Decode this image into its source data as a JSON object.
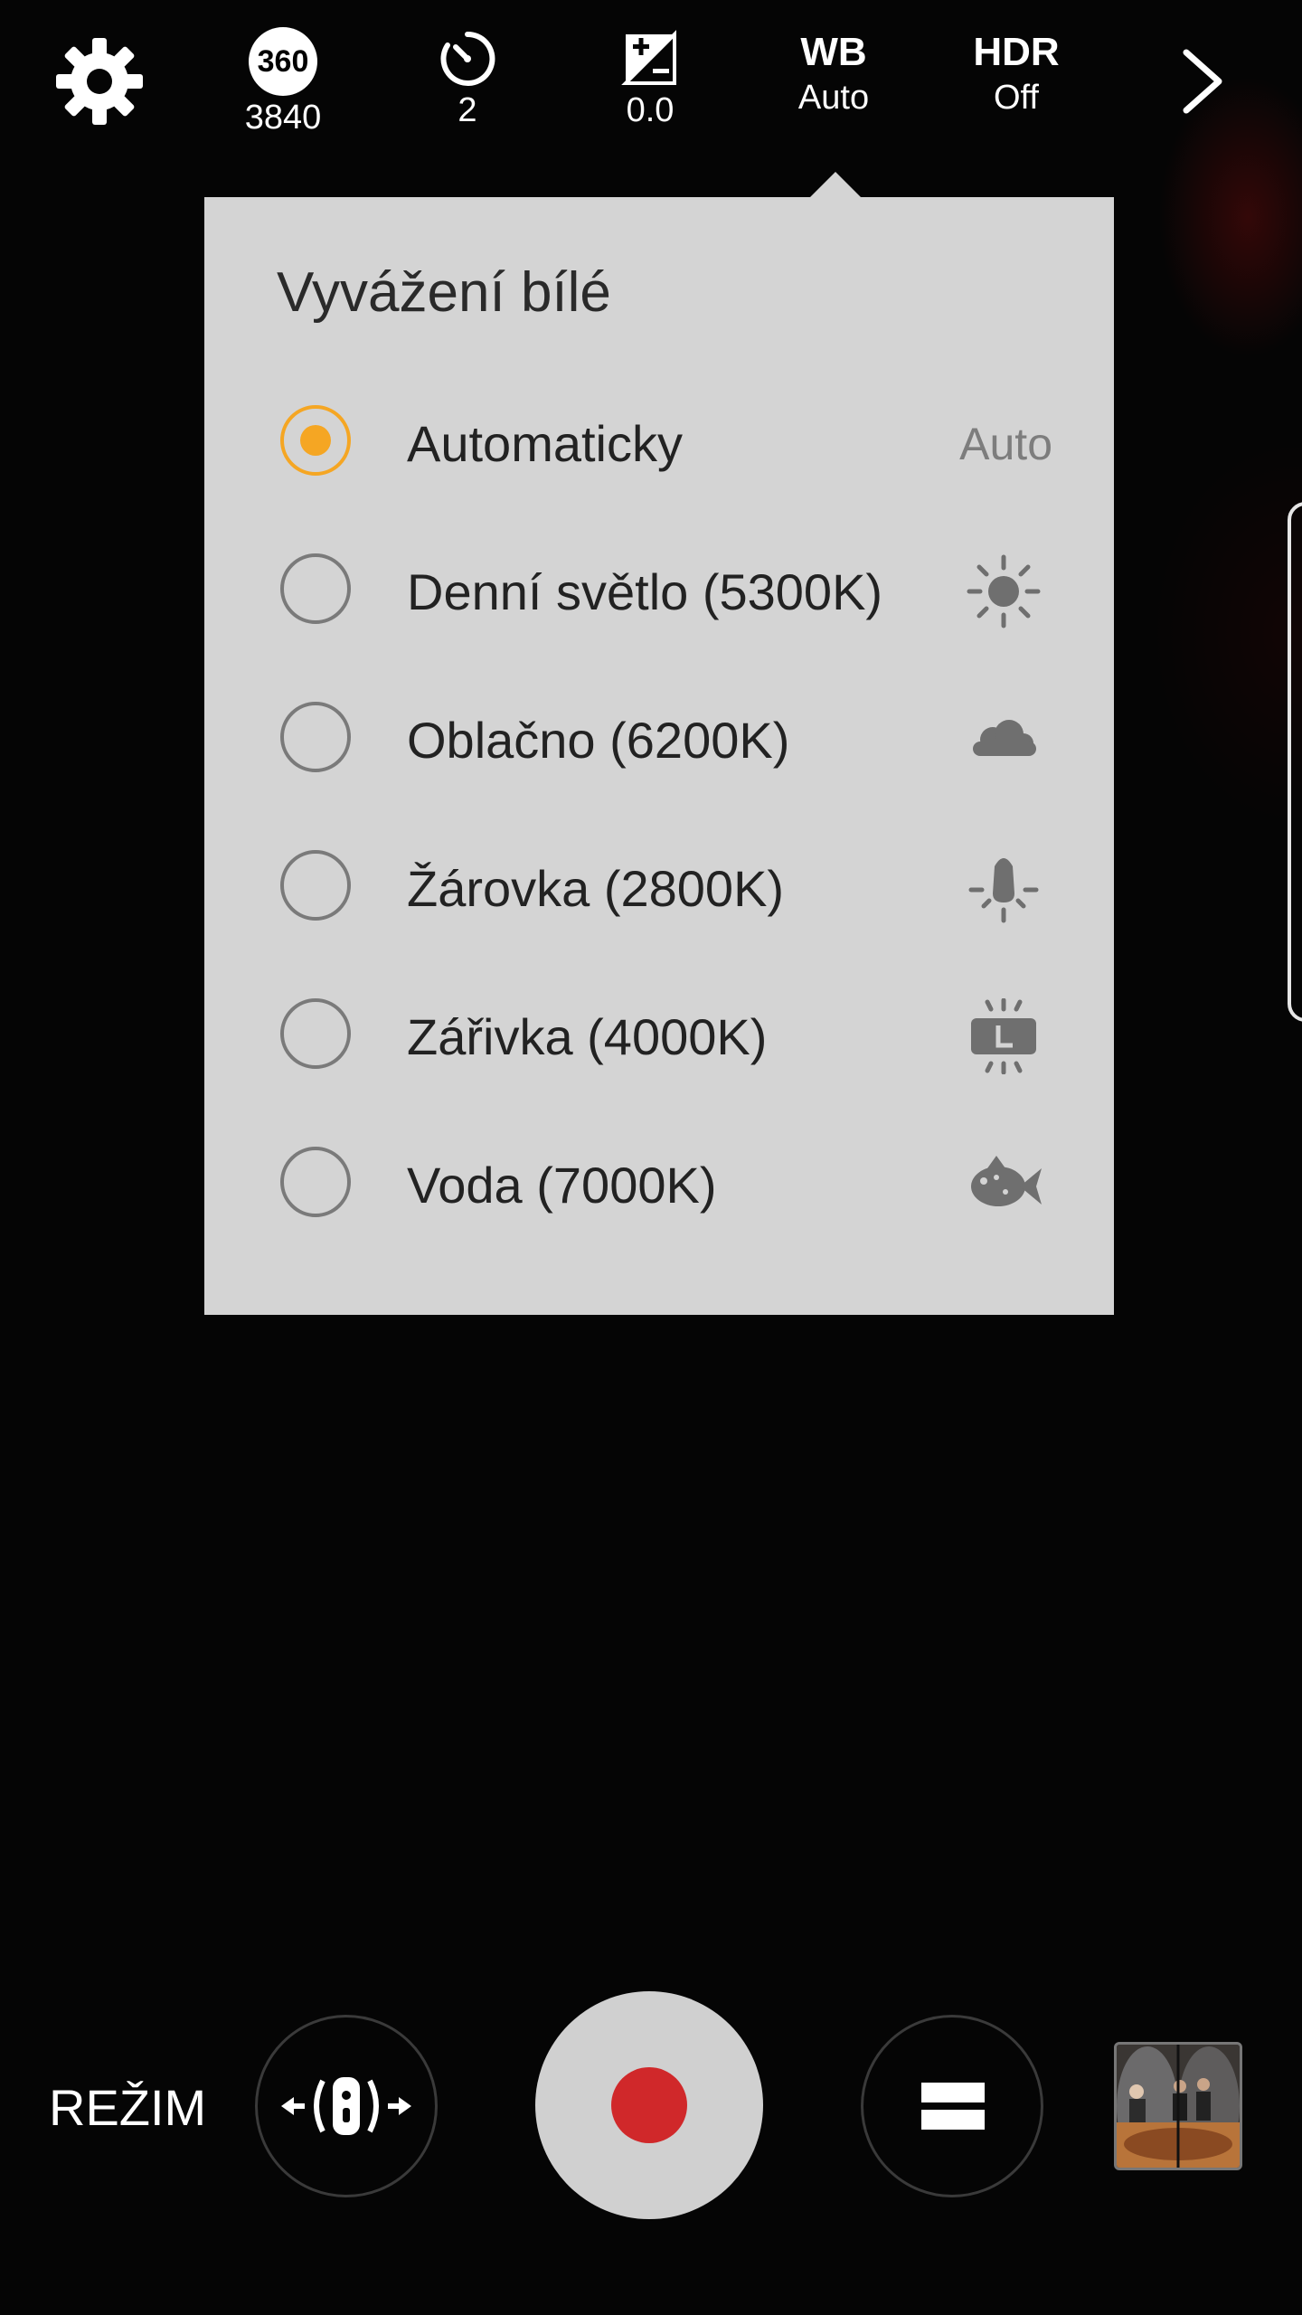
{
  "topbar": {
    "settings_icon": "gear-icon",
    "resolution": {
      "badge": "360",
      "value": "3840"
    },
    "timer": {
      "icon": "timer-icon",
      "value": "2"
    },
    "exposure": {
      "icon": "exposure-icon",
      "value": "0.0"
    },
    "wb": {
      "label": "WB",
      "value": "Auto"
    },
    "hdr": {
      "label": "HDR",
      "value": "Off"
    },
    "more_icon": "chevron-right-icon"
  },
  "popup": {
    "title": "Vyvážení bílé",
    "options": [
      {
        "label": "Automaticky",
        "tag": "Auto",
        "selected": true
      },
      {
        "label": "Denní světlo (5300K)",
        "icon": "sun-icon",
        "selected": false
      },
      {
        "label": "Oblačno (6200K)",
        "icon": "cloud-icon",
        "selected": false
      },
      {
        "label": "Žárovka (2800K)",
        "icon": "bulb-icon",
        "selected": false
      },
      {
        "label": "Zářivka (4000K)",
        "icon": "fluorescent-icon",
        "selected": false
      },
      {
        "label": "Voda (7000K)",
        "icon": "fish-icon",
        "selected": false
      }
    ]
  },
  "bottombar": {
    "mode_label": "REŽIM",
    "view_icon": "camera-view-icon",
    "record_icon": "record-icon",
    "layout_icon": "layout-icon",
    "gallery": "gallery-thumbnail"
  },
  "colors": {
    "accent": "#f5a623",
    "record": "#d0282a",
    "popup_bg": "#d4d4d4"
  }
}
